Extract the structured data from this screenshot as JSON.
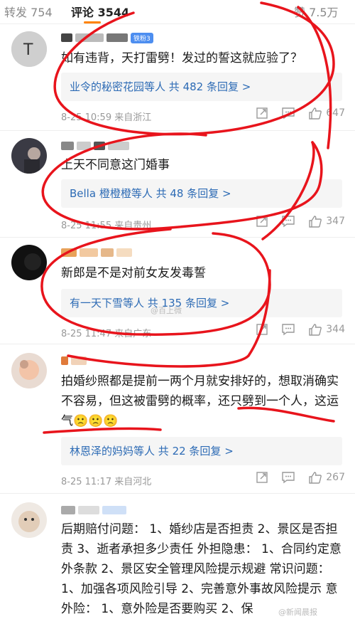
{
  "tabs": [
    {
      "label": "转发 754"
    },
    {
      "label": "评论 3544"
    },
    {
      "label": "赞 7.5万"
    }
  ],
  "comments": [
    {
      "badge": "铁粉3",
      "text": "如有违背，天打雷劈！发过的誓这就应验了？",
      "reply_names": "业令的秘密花园等人",
      "reply_count": "共 482 条回复 >",
      "time": "8-25 10:59",
      "location": "来自浙江",
      "likes": "647"
    },
    {
      "badge": "",
      "text": "上天不同意这门婚事",
      "reply_names": "Bella 橙橙橙等人",
      "reply_count": "共 48 条回复 >",
      "time": "8-25 11:55",
      "location": "来自贵州",
      "likes": "347"
    },
    {
      "badge": "",
      "text": "新郎是不是对前女友发毒誓",
      "reply_names": "有一天下雪等人",
      "reply_count": "共 135 条回复 >",
      "time": "8-25 11:47",
      "location": "来自广东",
      "likes": "344"
    },
    {
      "badge": "",
      "text": "拍婚纱照都是提前一两个月就安排好的，想取消确实不容易，但这被雷劈的概率，还只劈到一个人，这运气🙁🙁🙁",
      "reply_names": "林恩泽的妈妈等人",
      "reply_count": "共 22 条回复 >",
      "time": "8-25 11:17",
      "location": "来自河北",
      "likes": "267"
    },
    {
      "badge": "",
      "text": "后期赔付问题： 1、婚纱店是否担责 2、景区是否担责 3、逝者承担多少责任 外担隐患： 1、合同约定意外条款 2、景区安全管理风险提示规避 常识问题： 1、加强各项风险引导 2、完善意外事故风险提示 意外险： 1、意外险是否要购买 2、保"
    }
  ],
  "watermarks": {
    "mid": "@百上微",
    "bottom": "@新闻晨报"
  },
  "icons": [
    "share-icon",
    "comment-icon",
    "like-icon"
  ],
  "colors": {
    "accent": "#ff8200",
    "link": "#2d6bb5",
    "annotation": "#e8141c"
  }
}
